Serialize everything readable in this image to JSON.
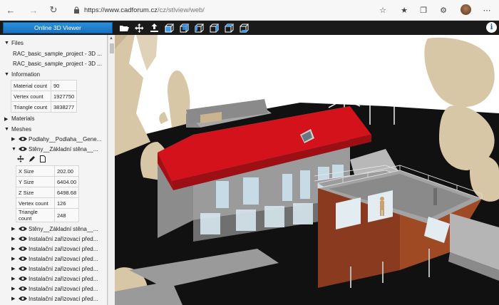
{
  "browser": {
    "url": "https://www.cadforum.cz/cz/stlview/web/",
    "url_host": "https://www.cadforum.cz",
    "url_path": "/cz/stlview/web/"
  },
  "app": {
    "viewer_button": "Online 3D Viewer",
    "toolbar_icons": [
      "folder-open-icon",
      "move-icon",
      "upload-icon",
      "cube-front-icon",
      "cube-back-icon",
      "cube-left-icon",
      "cube-right-icon",
      "cube-top-icon",
      "cube-bottom-icon"
    ],
    "info_icon": "i"
  },
  "panel": {
    "files": {
      "title": "Files",
      "items": [
        "RAC_basic_sample_project - 3D ...",
        "RAC_basic_sample_project - 3D ..."
      ]
    },
    "information": {
      "title": "Information",
      "rows": [
        {
          "label": "Material count",
          "value": "90"
        },
        {
          "label": "Vertex count",
          "value": "1927750"
        },
        {
          "label": "Triangle count",
          "value": "3838277"
        }
      ]
    },
    "materials": {
      "title": "Materials"
    },
    "meshes": {
      "title": "Meshes",
      "items": [
        {
          "label": "Podlahy__Podlaha__Gene...",
          "expanded": false
        },
        {
          "label": "Stěny__Základní stěna__...",
          "expanded": true
        }
      ],
      "details": [
        {
          "label": "X Size",
          "value": "202.00"
        },
        {
          "label": "Y Size",
          "value": "6404.00"
        },
        {
          "label": "Z Size",
          "value": "6498.68"
        },
        {
          "label": "Vertex count",
          "value": "126"
        },
        {
          "label": "Triangle count",
          "value": "248"
        }
      ],
      "more_items": [
        "Stěny__Základní stěna__...",
        "Instalační zařizovací před...",
        "Instalační zařizovací před...",
        "Instalační zařizovací před...",
        "Instalační zařizovací před...",
        "Instalační zařizovací před...",
        "Instalační zařizovací před...",
        "Instalační zařizovací před...",
        "Instalační zařizovací před..."
      ]
    }
  },
  "colors": {
    "toolbar_bg": "#1a1a1a",
    "accent": "#1f7fd0",
    "roof": "#d3121b",
    "terrain": "#111111",
    "trees": "#d8c7a6",
    "walls": "#9a9a9a",
    "cladding": "#8a3b1f"
  }
}
